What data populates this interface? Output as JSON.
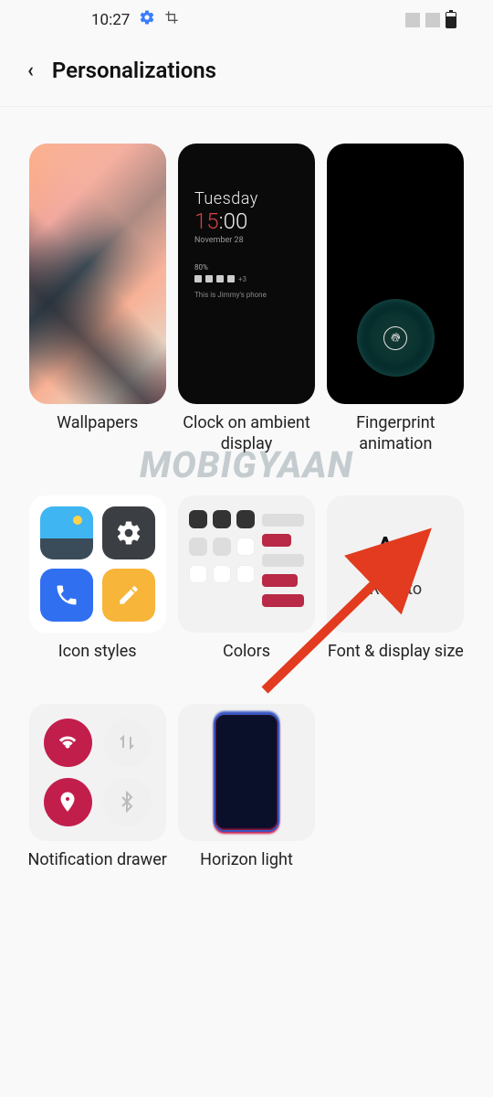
{
  "status": {
    "time": "10:27"
  },
  "page": {
    "title": "Personalizations"
  },
  "tiles": {
    "wallpaper": {
      "label": "Wallpapers"
    },
    "ambient": {
      "label": "Clock on ambient display",
      "day": "Tuesday",
      "time_hour": "15",
      "time_min": ":00",
      "date": "November 28",
      "battery": "80%",
      "notif_extra": "+3",
      "phone_text": "This is Jimmy's phone"
    },
    "fingerprint": {
      "label": "Fingerprint animation"
    },
    "iconstyles": {
      "label": "Icon styles"
    },
    "colors": {
      "label": "Colors"
    },
    "font": {
      "label": "Font & display size",
      "sample": "Aa",
      "name": "Roboto"
    },
    "drawer": {
      "label": "Notification drawer"
    },
    "horizon": {
      "label": "Horizon light"
    }
  },
  "watermark": "MOBIGYAAN"
}
